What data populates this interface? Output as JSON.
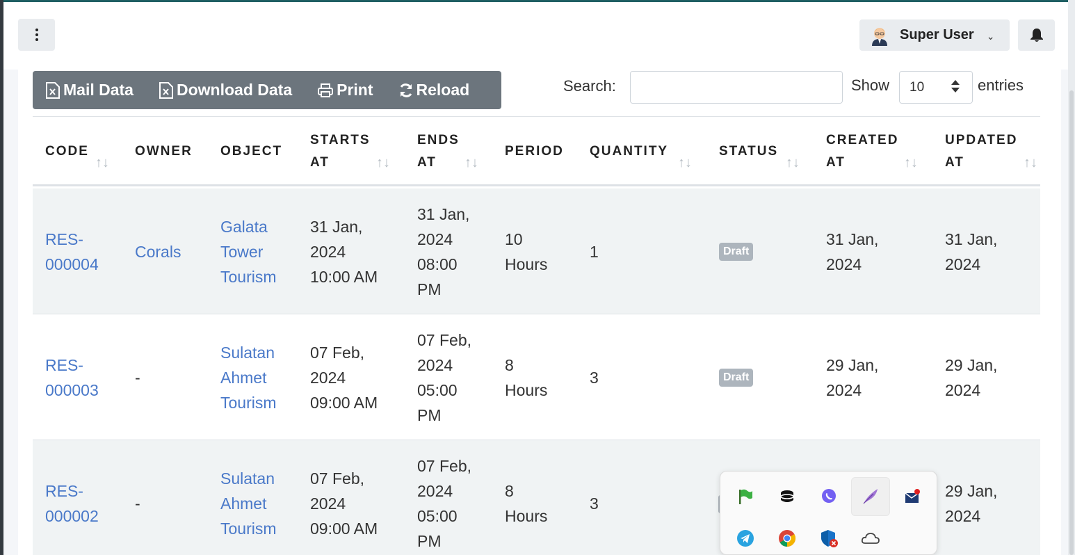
{
  "navbar": {
    "user_name": "Super User"
  },
  "toolbar": {
    "mail_label": "Mail Data",
    "download_label": "Download Data",
    "print_label": "Print",
    "reload_label": "Reload"
  },
  "filters": {
    "search_label": "Search:",
    "search_value": "",
    "show_label": "Show",
    "page_size": "10",
    "entries_label": "entries"
  },
  "table": {
    "columns": [
      {
        "line1": "CODE",
        "line2": ""
      },
      {
        "line1": "OWNER",
        "line2": ""
      },
      {
        "line1": "OBJECT",
        "line2": ""
      },
      {
        "line1": "STARTS",
        "line2": "AT"
      },
      {
        "line1": "ENDS",
        "line2": "AT"
      },
      {
        "line1": "PERIOD",
        "line2": ""
      },
      {
        "line1": "QUANTITY",
        "line2": ""
      },
      {
        "line1": "STATUS",
        "line2": ""
      },
      {
        "line1": "CREATED",
        "line2": "AT"
      },
      {
        "line1": "UPDATED",
        "line2": "AT"
      }
    ],
    "rows": [
      {
        "code": [
          "RES-",
          "000004"
        ],
        "owner": [
          "Corals"
        ],
        "object": [
          "Galata",
          "Tower",
          "Tourism"
        ],
        "starts": [
          "31 Jan,",
          "2024",
          "10:00 AM"
        ],
        "ends": [
          "31 Jan,",
          "2024",
          "08:00",
          "PM"
        ],
        "period": [
          "10",
          "Hours"
        ],
        "quantity": "1",
        "status": "Draft",
        "created": [
          "31 Jan,",
          "2024"
        ],
        "updated": [
          "31 Jan,",
          "2024"
        ]
      },
      {
        "code": [
          "RES-",
          "000003"
        ],
        "owner": [
          "-"
        ],
        "object": [
          "Sulatan",
          "Ahmet",
          "Tourism"
        ],
        "starts": [
          "07 Feb,",
          "2024",
          "09:00 AM"
        ],
        "ends": [
          "07 Feb,",
          "2024",
          "05:00",
          "PM"
        ],
        "period": [
          "8",
          "Hours"
        ],
        "quantity": "3",
        "status": "Draft",
        "created": [
          "29 Jan,",
          "2024"
        ],
        "updated": [
          "29 Jan,",
          "2024"
        ]
      },
      {
        "code": [
          "RES-",
          "000002"
        ],
        "owner": [
          "-"
        ],
        "object": [
          "Sulatan",
          "Ahmet",
          "Tourism"
        ],
        "starts": [
          "07 Feb,",
          "2024",
          "09:00 AM"
        ],
        "ends": [
          "07 Feb,",
          "2024",
          "05:00",
          "PM"
        ],
        "period": [
          "8",
          "Hours"
        ],
        "quantity": "3",
        "status": "",
        "created": [
          "",
          ""
        ],
        "updated": [
          "29 Jan,",
          "2024"
        ]
      }
    ]
  },
  "tray": {
    "icons": [
      "green-flag-icon",
      "database-icon",
      "viber-icon",
      "feather-icon",
      "mail-tray-icon",
      "telegram-icon",
      "chrome-icon",
      "security-shield-icon",
      "onedrive-cloud-icon"
    ]
  },
  "colors": {
    "link": "#4a79c9",
    "toolbar_bg": "#6c757d",
    "badge_bg": "#adb5bd",
    "stripe": "#f0f3f4"
  }
}
